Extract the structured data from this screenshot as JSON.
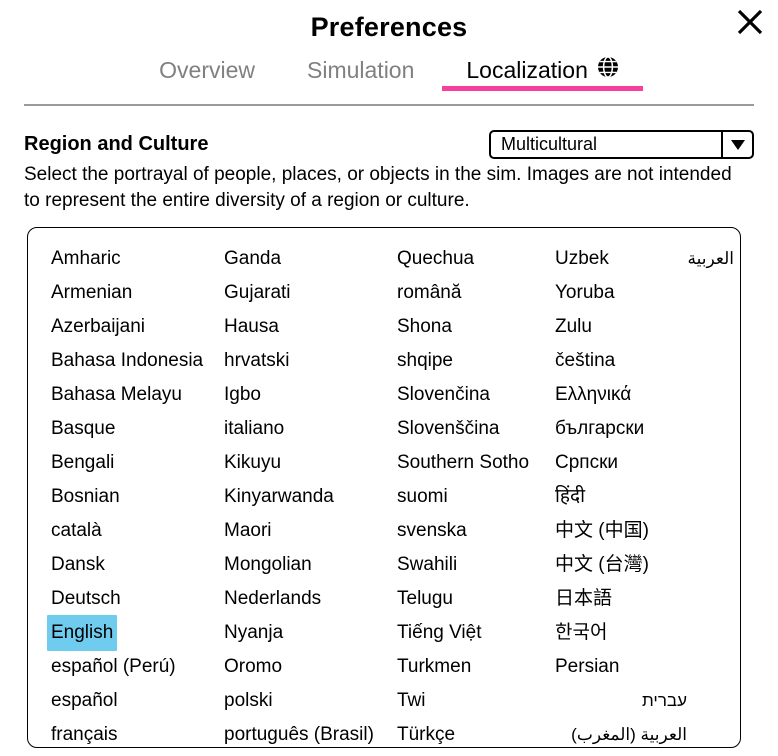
{
  "dialog": {
    "title": "Preferences",
    "close_icon": "close-icon"
  },
  "tabs": [
    {
      "label": "Overview",
      "active": false,
      "icon": null
    },
    {
      "label": "Simulation",
      "active": false,
      "icon": null
    },
    {
      "label": "Localization",
      "active": true,
      "icon": "globe-icon"
    }
  ],
  "region_and_culture": {
    "title": "Region and Culture",
    "description": "Select the portrayal of people, places, or objects in the sim. Images are not intended to represent the entire diversity of a region or culture.",
    "select": {
      "value": "Multicultural",
      "arrow_icon": "chevron-down-icon"
    }
  },
  "language_list": {
    "selected": "English",
    "columns": [
      {
        "id": "column-1",
        "items": [
          "Amharic",
          "Armenian",
          "Azerbaijani",
          "Bahasa Indonesia",
          "Bahasa Melayu",
          "Basque",
          "Bengali",
          "Bosnian",
          "català",
          "Dansk",
          "Deutsch",
          "English",
          "español (Perú)",
          "español",
          "français"
        ]
      },
      {
        "id": "column-2",
        "items": [
          "Ganda",
          "Gujarati",
          "Hausa",
          "hrvatski",
          "Igbo",
          "italiano",
          "Kikuyu",
          "Kinyarwanda",
          "Maori",
          "Mongolian",
          "Nederlands",
          "Nyanja",
          "Oromo",
          "polski",
          "português (Brasil)"
        ]
      },
      {
        "id": "column-3",
        "items": [
          "Quechua",
          "română",
          "Shona",
          "shqipe",
          "Slovenčina",
          "Slovenščina",
          "Southern Sotho",
          "suomi",
          "svenska",
          "Swahili",
          "Telugu",
          "Tiếng Việt",
          "Turkmen",
          "Twi",
          "Türkçe"
        ]
      },
      {
        "id": "column-4",
        "items": [
          "Uzbek",
          "Yoruba",
          "Zulu",
          "čeština",
          "Ελληνικά",
          "български",
          "Српски",
          "हिंदी",
          "中文 (中国)",
          "中文 (台灣)",
          "日本語",
          "한국어",
          "Persian",
          "עברית",
          "العربية (المغرب)"
        ]
      },
      {
        "id": "column-5",
        "items": [
          "العربية"
        ]
      }
    ]
  },
  "colors": {
    "accent_pink": "#f73f9b",
    "selection_blue": "#6fccef",
    "tab_inactive": "#808080",
    "rule_gray": "#9a9a9a"
  }
}
